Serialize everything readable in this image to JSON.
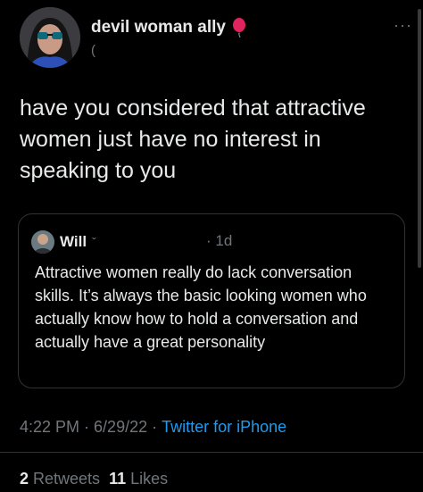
{
  "author": {
    "display_name": "devil woman ally",
    "badge_icon": "balloon-icon",
    "handle_mark": "(",
    "more_icon": "···"
  },
  "tweet": {
    "text": "have you considered that attractive women just have no interest in speaking to you"
  },
  "quote": {
    "name": "Will",
    "handle_mark": "ˇ",
    "time": "· 1d",
    "text": "Attractive women really do lack conversation skills. It’s always the basic looking women who actually know how to hold a conversation and actually have a great personality"
  },
  "meta": {
    "time": "4:22 PM",
    "sep1": " · ",
    "date": "6/29/22",
    "sep2": " · ",
    "source": "Twitter for iPhone"
  },
  "stats": {
    "retweets_count": "2",
    "retweets_label": "Retweets",
    "likes_count": "11",
    "likes_label": "Likes"
  },
  "colors": {
    "background": "#000000",
    "text": "#e7e9ea",
    "secondary": "#71767b",
    "link": "#1d9bf0",
    "balloon": "#e0245e"
  }
}
